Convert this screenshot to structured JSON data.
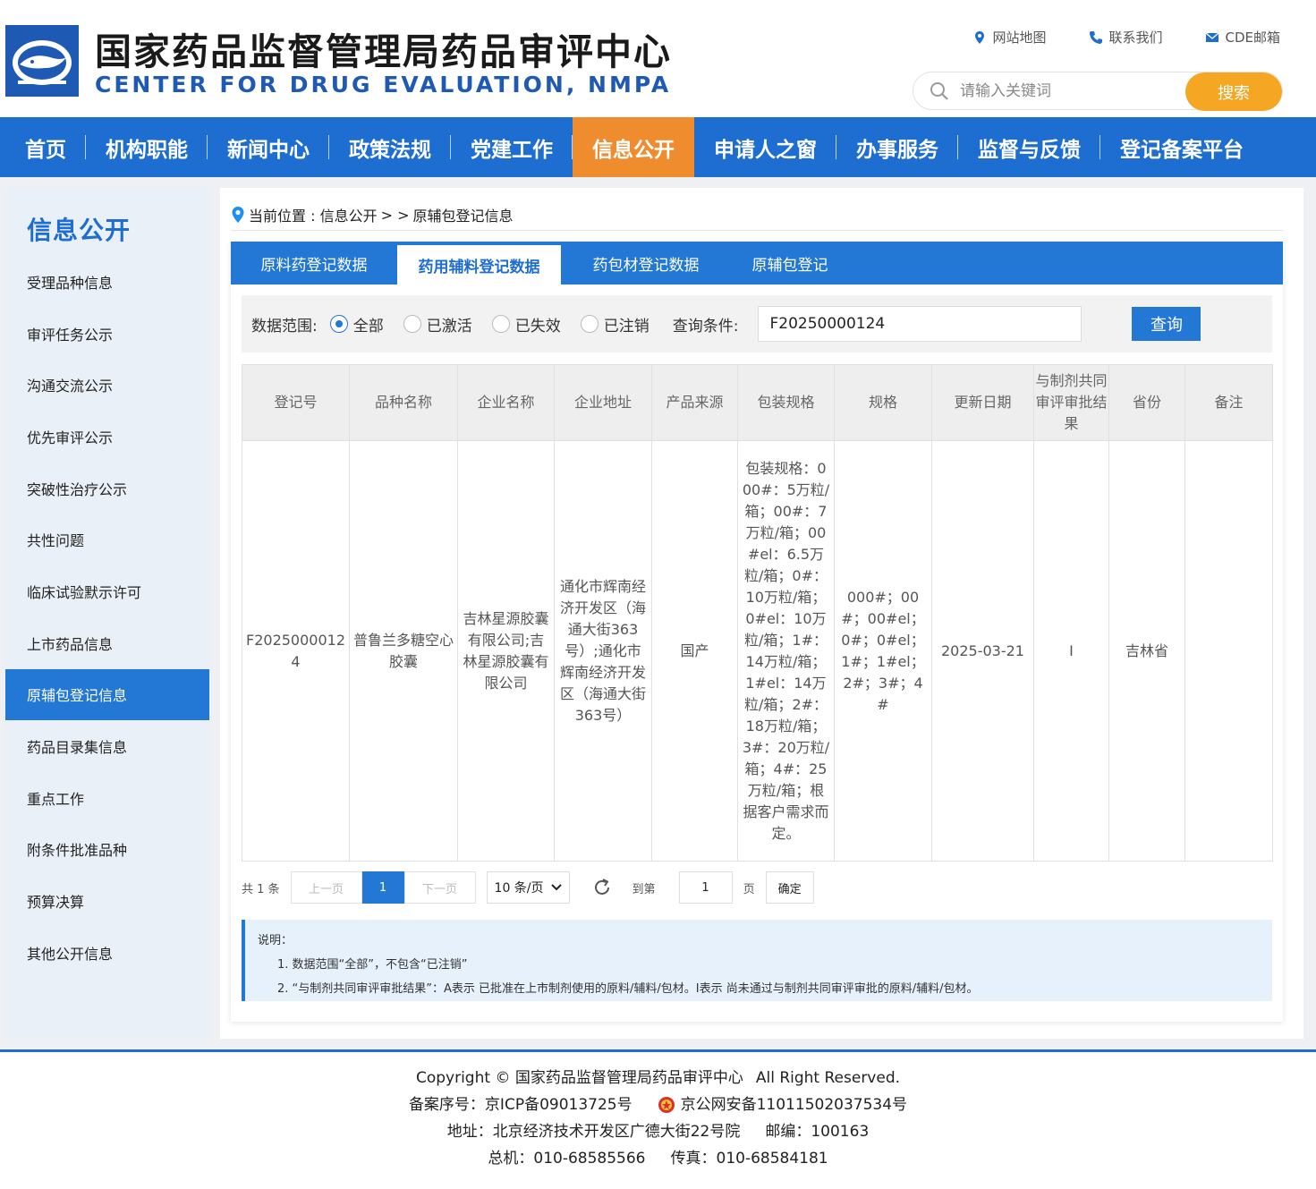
{
  "header": {
    "title_cn": "国家药品监督管理局药品审评中心",
    "title_en": "CENTER FOR DRUG EVALUATION, NMPA",
    "links": [
      "网站地图",
      "联系我们",
      "CDE邮箱"
    ],
    "search_placeholder": "请输入关键词",
    "search_button": "搜索"
  },
  "nav": [
    "首页",
    "机构职能",
    "新闻中心",
    "政策法规",
    "党建工作",
    "信息公开",
    "申请人之窗",
    "办事服务",
    "监督与反馈",
    "登记备案平台"
  ],
  "nav_active": "信息公开",
  "sidebar": {
    "title": "信息公开",
    "items": [
      "受理品种信息",
      "审评任务公示",
      "沟通交流公示",
      "优先审评公示",
      "突破性治疗公示",
      "共性问题",
      "临床试验默示许可",
      "上市药品信息",
      "原辅包登记信息",
      "药品目录集信息",
      "重点工作",
      "附条件批准品种",
      "预算决算",
      "其他公开信息"
    ],
    "active": "原辅包登记信息"
  },
  "breadcrumb": {
    "prefix": "当前位置 : 信息公开",
    "sep": "> >",
    "current": "原辅包登记信息"
  },
  "tabs": [
    "原料药登记数据",
    "药用辅料登记数据",
    "药包材登记数据",
    "原辅包登记"
  ],
  "tab_active": "药用辅料登记数据",
  "filter": {
    "scope_label": "数据范围:",
    "options": [
      "全部",
      "已激活",
      "已失效",
      "已注销"
    ],
    "selected": "全部",
    "query_label": "查询条件:",
    "query_value": "F20250000124",
    "query_button": "查询"
  },
  "table": {
    "headers": [
      "登记号",
      "品种名称",
      "企业名称",
      "企业地址",
      "产品来源",
      "包装规格",
      "规格",
      "更新日期",
      "与制剂共同审评审批结果",
      "省份",
      "备注"
    ],
    "rows": [
      [
        "F20250000124",
        "普鲁兰多糖空心胶囊",
        "吉林星源胶囊有限公司;吉林星源胶囊有限公司",
        "通化市辉南经济开发区（海通大街363号）;通化市辉南经济开发区（海通大街363号）",
        "国产",
        "包装规格：000#：5万粒/箱；00#：7万粒/箱；00#el：6.5万粒/箱；0#：10万粒/箱；0#el：10万粒/箱；1#：14万粒/箱；1#el：14万粒/箱；2#：18万粒/箱；3#：20万粒/箱；4#：25万粒/箱；根据客户需求而定。",
        "000#；00#；00#el；0#；0#el；1#；1#el；2#；3#；4#",
        "2025-03-21",
        "I",
        "吉林省",
        ""
      ]
    ]
  },
  "pager": {
    "total": "共 1 条",
    "prev": "上一页",
    "page": "1",
    "next": "下一页",
    "size": "10 条/页",
    "goto": "到第",
    "goto_value": "1",
    "page_unit": "页",
    "confirm": "确定"
  },
  "note": {
    "title": "说明：",
    "lines": [
      "1. 数据范围“全部”，不包含“已注销”",
      "2. “与制剂共同审评审批结果”：A表示 已批准在上市制剂使用的原料/辅料/包材。I表示 尚未通过与制剂共同审评审批的原料/辅料/包材。"
    ]
  },
  "footer": {
    "copyright": "Copyright © 国家药品监督管理局药品审评中心",
    "rights": "All Right Reserved.",
    "icp": "备案序号：京ICP备09013725号",
    "police": "京公网安备11011502037534号",
    "address": "地址：北京经济技术开发区广德大街22号院",
    "postcode": "邮编：100163",
    "phone": "总机：010-68585566",
    "fax": "传真：010-68584181"
  },
  "colors": {
    "primary_blue": "#1e6ed2",
    "nav_active_orange": "#ee8c2e",
    "search_button_orange": "#f5a623"
  }
}
